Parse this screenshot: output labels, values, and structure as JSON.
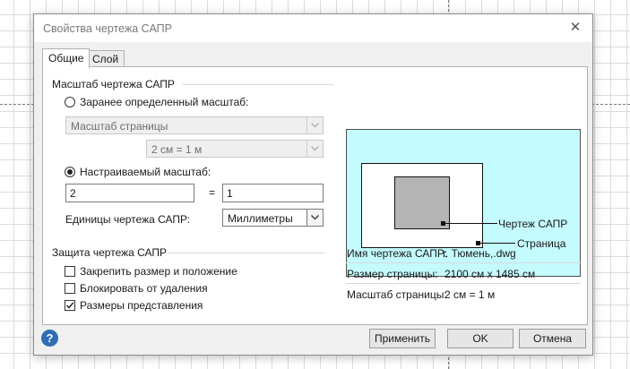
{
  "dialog": {
    "title": "Свойства чертежа САПР",
    "close_glyph": "✕"
  },
  "tabs": [
    {
      "label": "Общие",
      "active": true
    },
    {
      "label": "Слой",
      "active": false
    }
  ],
  "scale_group": {
    "title": "Масштаб чертежа САПР",
    "predefined_label": "Заранее определенный масштаб:",
    "predefined_selected": false,
    "predefined_type_value": "Масштаб страницы",
    "predefined_ratio_value": "2 см = 1 м",
    "custom_label": "Настраиваемый масштаб:",
    "custom_selected": true,
    "custom_left_value": "2",
    "equals": "=",
    "custom_right_value": "1",
    "units_label": "Единицы чертежа САПР:",
    "units_value": "Миллиметры"
  },
  "protection_group": {
    "title": "Защита чертежа САПР",
    "items": [
      {
        "label": "Закрепить размер и положение",
        "checked": false
      },
      {
        "label": "Блокировать от удаления",
        "checked": false
      },
      {
        "label": "Размеры представления",
        "checked": true
      }
    ]
  },
  "preview": {
    "drawing_label": "Чертеж САПР",
    "page_label": "Страница"
  },
  "info": {
    "name_label": "Имя чертежа САПР:",
    "name_value": "г. Тюмень,.dwg",
    "page_size_label": "Размер страницы:",
    "page_size_value": "2100 см x 1485 см",
    "page_scale_label": "Масштаб страницы:",
    "page_scale_value": "2 см = 1 м"
  },
  "buttons": {
    "apply": "Применить",
    "ok": "OK",
    "cancel": "Отмена",
    "help_glyph": "?"
  },
  "colors": {
    "preview_background": "#c4fbff",
    "help_icon": "#2f6db5"
  }
}
